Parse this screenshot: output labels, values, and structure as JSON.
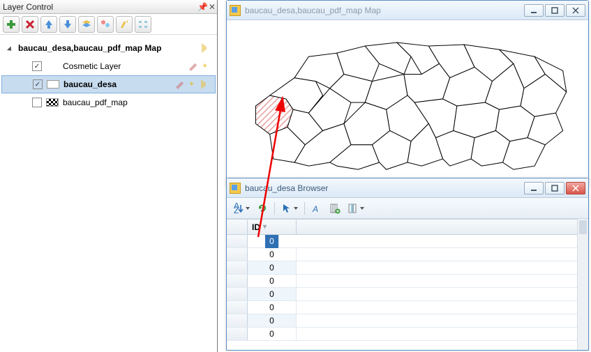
{
  "layerControl": {
    "title": "Layer Control",
    "root": "baucau_desa,baucau_pdf_map Map",
    "layers": [
      {
        "name": "Cosmetic Layer",
        "checked": true,
        "swatch": "none",
        "selected": false
      },
      {
        "name": "baucau_desa",
        "checked": true,
        "swatch": "blank",
        "selected": true,
        "bold": true
      },
      {
        "name": "baucau_pdf_map",
        "checked": false,
        "swatch": "checker",
        "selected": false
      }
    ]
  },
  "mapWindow": {
    "title": "baucau_desa,baucau_pdf_map Map"
  },
  "browserWindow": {
    "title": "baucau_desa Browser",
    "column": "ID",
    "rows": [
      0,
      0,
      0,
      0,
      0,
      0,
      0,
      0
    ],
    "selectedRowIndex": 0
  },
  "icons": {
    "add": "add-icon",
    "remove": "remove-icon",
    "up": "up-icon",
    "down": "down-icon",
    "layers": "layers-icon",
    "tools": "tools-icon",
    "brush": "brush-icon",
    "hotlink": "hotlink-icon",
    "reorder": "reorder-icon",
    "pin": "pin-icon",
    "close": "close-icon",
    "min": "minimize-icon",
    "max": "maximize-icon",
    "sort": "sort-icon",
    "refresh": "refresh-icon",
    "select": "select-arrow-icon",
    "font": "font-icon",
    "addcol": "add-column-icon",
    "pickcol": "pick-columns-icon"
  }
}
